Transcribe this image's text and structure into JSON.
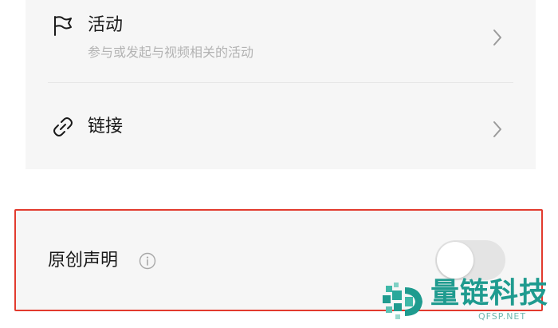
{
  "settings": {
    "activity": {
      "title": "活动",
      "subtitle": "参与或发起与视频相关的活动",
      "icon": "flag-icon"
    },
    "link": {
      "title": "链接",
      "icon": "link-icon"
    },
    "original_declaration": {
      "label": "原创声明",
      "info_icon": "info-icon",
      "toggle_on": false
    }
  },
  "watermark": {
    "brand": "量链科技",
    "domain": "QFSP.NET"
  },
  "colors": {
    "card_background": "#f6f6f6",
    "highlight_border": "#e23b2e",
    "text_primary": "#1a1a1a",
    "text_secondary": "#b3b3b3",
    "toggle_off": "#e4e4e4",
    "watermark_accent": "#1f9b8f"
  }
}
